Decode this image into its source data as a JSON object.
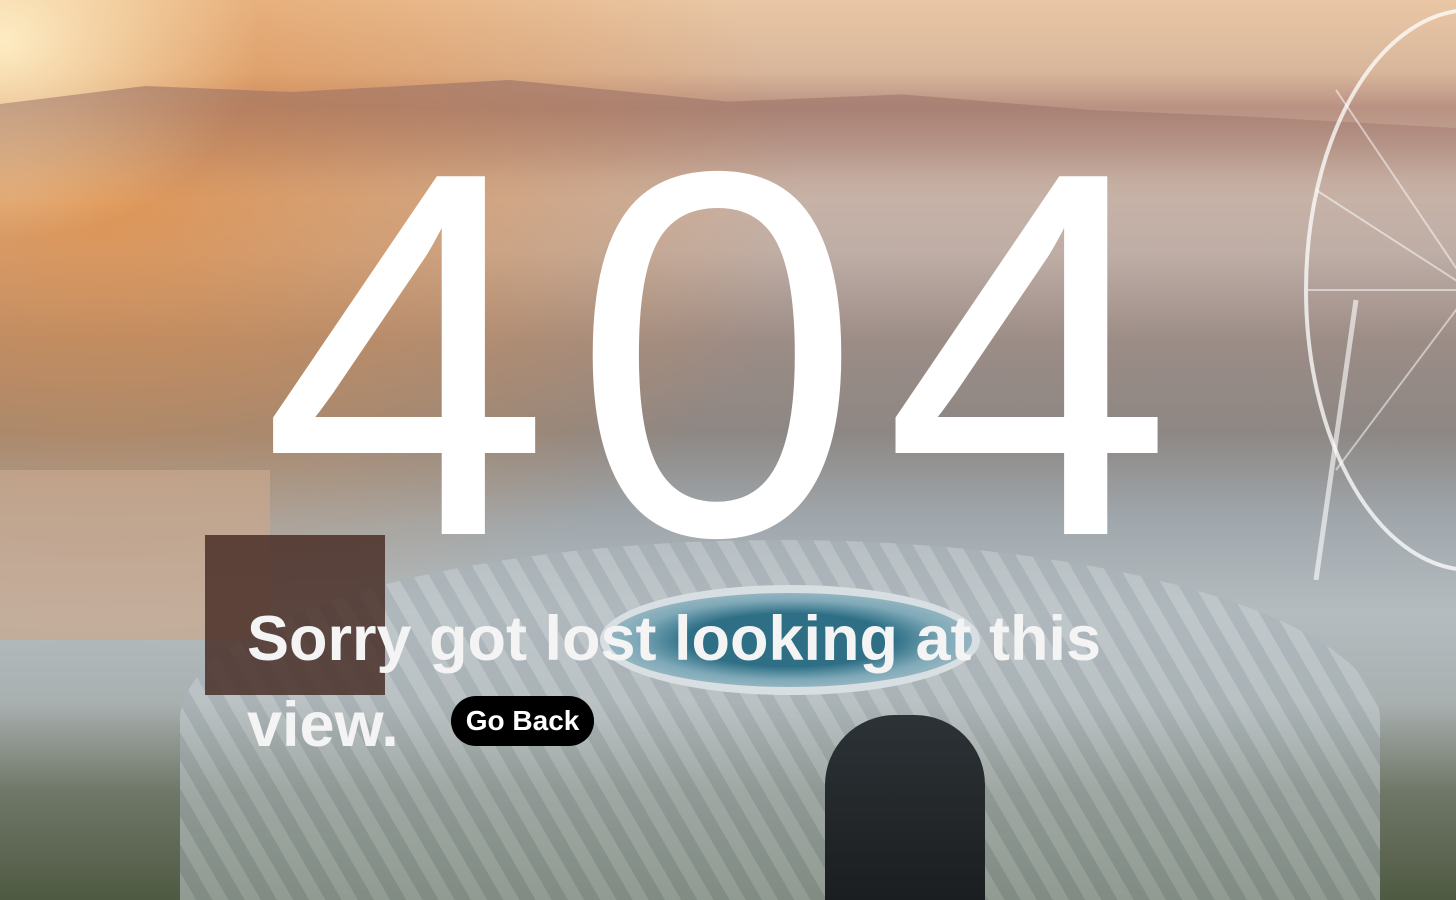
{
  "error": {
    "code": "404",
    "message": "Sorry got lost looking at this view.",
    "back_button_label": "Go Back"
  },
  "colors": {
    "text": "#ffffff",
    "button_bg": "#000000"
  }
}
